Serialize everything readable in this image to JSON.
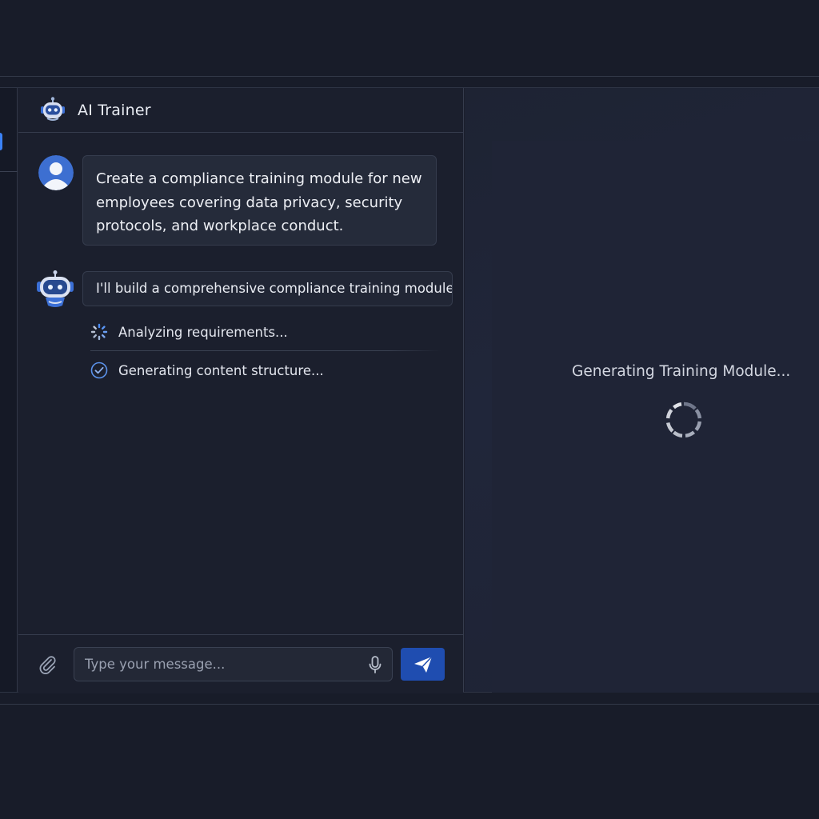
{
  "chat": {
    "header": {
      "title": "AI Trainer",
      "icon": "robot-icon"
    },
    "messages": [
      {
        "role": "user",
        "avatar": "user-avatar-icon",
        "text": "Create a compliance training module for new employees covering data privacy, security protocols, and workplace conduct."
      },
      {
        "role": "assistant",
        "avatar": "robot-avatar-icon",
        "text": "I'll build a comprehensive compliance training module..."
      }
    ],
    "steps": [
      {
        "label": "Analyzing requirements...",
        "status": "in-progress",
        "icon": "spinner-icon"
      },
      {
        "label": "Generating content structure...",
        "status": "done",
        "icon": "check-circle-icon"
      }
    ],
    "composer": {
      "placeholder": "Type your message...",
      "value": "",
      "attach_icon": "paperclip-icon",
      "mic_icon": "microphone-icon",
      "send_icon": "send-icon"
    }
  },
  "preview": {
    "status_text": "Generating Training Module...",
    "icon": "loading-spinner-icon"
  },
  "colors": {
    "background": "#181c29",
    "panel": "#1b1f2d",
    "accent": "#3b82f6",
    "send_button": "#1f4db0"
  }
}
